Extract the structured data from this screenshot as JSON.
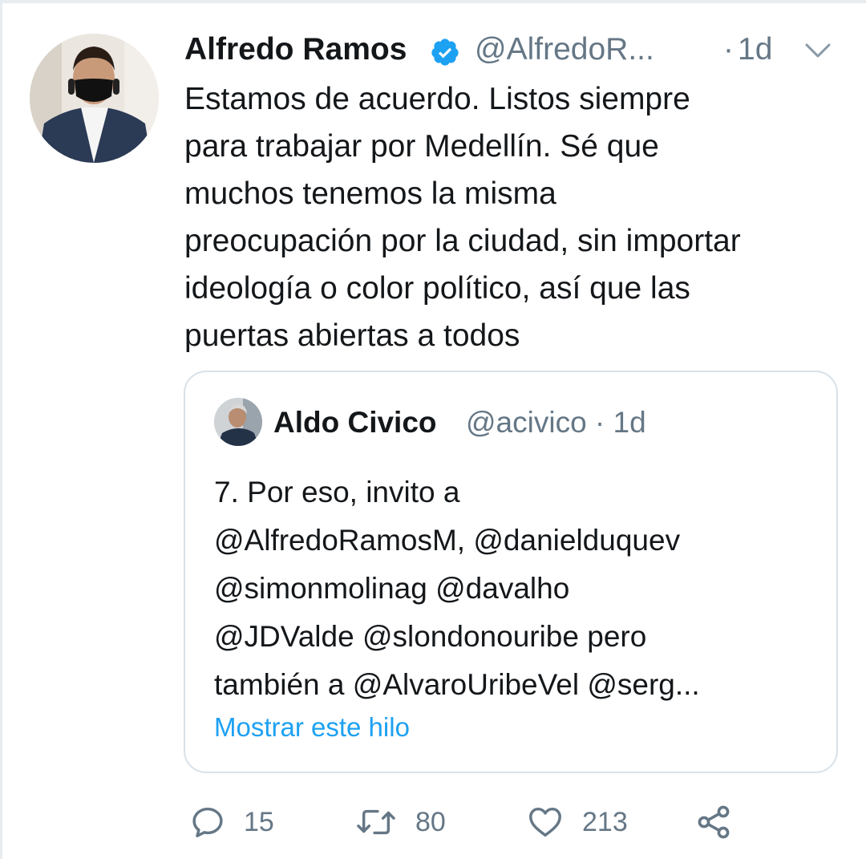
{
  "tweet": {
    "author_name": "Alfredo Ramos",
    "handle": "@AlfredoR...",
    "separator": "·",
    "time": "1d",
    "text_lines": [
      "Estamos de acuerdo. Listos siempre",
      "para trabajar por Medellín. Sé que",
      "muchos tenemos la misma",
      "preocupación por la ciudad, sin importar",
      "ideología o color político, así que las",
      "puertas abiertas a todos"
    ]
  },
  "quoted": {
    "author_name": "Aldo Civico",
    "handle_time": "@acivico · 1d",
    "text_lines": [
      "7. Por eso, invito a",
      "@AlfredoRamosM, @danielduquev",
      "@simonmolinag @davalho",
      "@JDValde @slondonouribe pero",
      "también a @AlvaroUribeVel @serg..."
    ],
    "show_thread": "Mostrar este hilo"
  },
  "actions": {
    "reply_count": "15",
    "retweet_count": "80",
    "like_count": "213"
  },
  "icons": {
    "verified": "verified-badge-icon",
    "more": "chevron-down-icon",
    "reply": "reply-icon",
    "retweet": "retweet-icon",
    "like": "heart-icon",
    "share": "share-icon"
  },
  "colors": {
    "text": "#14171a",
    "secondary": "#657786",
    "accent": "#1da1f2",
    "border": "#d9e1e8"
  }
}
